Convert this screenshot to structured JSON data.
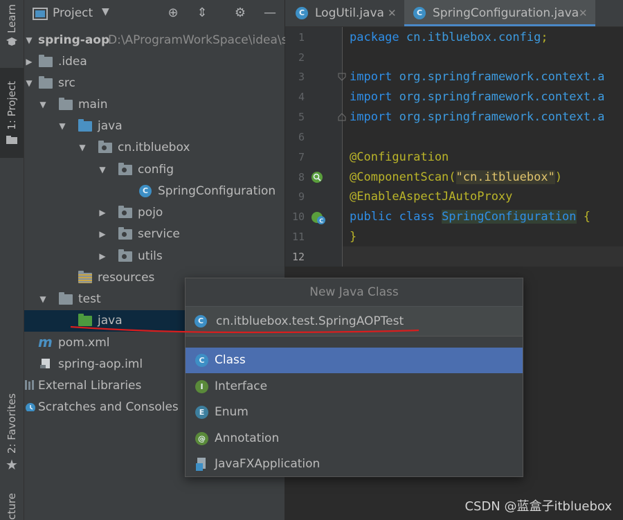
{
  "stripe": {
    "learn": "Learn",
    "project": "1: Project",
    "favorites": "2: Favorites",
    "structure": "Structure"
  },
  "panel": {
    "title": "Project",
    "dropdown_icon": "chevron-down-icon",
    "tools": [
      "target-icon",
      "collapse-icon",
      "gear-icon",
      "minimize-icon"
    ]
  },
  "tree": [
    {
      "label": "spring-aop",
      "path": "D:\\AProgramWorkSpace\\idea\\sp",
      "bold": true
    },
    {
      "label": ".idea"
    },
    {
      "label": "src"
    },
    {
      "label": "main"
    },
    {
      "label": "java"
    },
    {
      "label": "cn.itbluebox"
    },
    {
      "label": "config"
    },
    {
      "label": "SpringConfiguration"
    },
    {
      "label": "pojo"
    },
    {
      "label": "service"
    },
    {
      "label": "utils"
    },
    {
      "label": "resources"
    },
    {
      "label": "test"
    },
    {
      "label": "java"
    },
    {
      "label": "pom.xml"
    },
    {
      "label": "spring-aop.iml"
    },
    {
      "label": "External Libraries"
    },
    {
      "label": "Scratches and Consoles"
    }
  ],
  "editor": {
    "tabs": [
      {
        "label": "LogUtil.java",
        "active": false
      },
      {
        "label": "SpringConfiguration.java",
        "active": true
      }
    ],
    "line_numbers": [
      "1",
      "2",
      "3",
      "4",
      "5",
      "6",
      "7",
      "8",
      "9",
      "10",
      "11",
      "12"
    ],
    "code": {
      "l1_kw": "package ",
      "l1_rest": "cn.itbluebox.config",
      "l1_semi": ";",
      "import_kw": "import ",
      "import_rest": "org.springframework.context.a",
      "l7": "@Configuration",
      "l8_ann": "@ComponentScan(",
      "l8_str": "\"cn.itbluebox\"",
      "l8_close": ")",
      "l9": "@EnableAspectJAutoProxy",
      "l10_kw": "public class ",
      "l10_name": "SpringConfiguration",
      "l10_brace": " {",
      "l11": "}"
    }
  },
  "popup": {
    "title": "New Java Class",
    "input_value": "cn.itbluebox.test.SpringAOPTest",
    "kinds": [
      {
        "label": "Class",
        "icon": "C",
        "color": "#3d8fc5"
      },
      {
        "label": "Interface",
        "icon": "I",
        "color": "#5a8a3a"
      },
      {
        "label": "Enum",
        "icon": "E",
        "color": "#3d7f9e"
      },
      {
        "label": "Annotation",
        "icon": "@",
        "color": "#5a8a3a"
      },
      {
        "label": "JavaFXApplication",
        "icon": "javafx-icon",
        "color": "#9aa7b0"
      }
    ]
  },
  "watermark": "CSDN @蓝盒子itbluebox"
}
